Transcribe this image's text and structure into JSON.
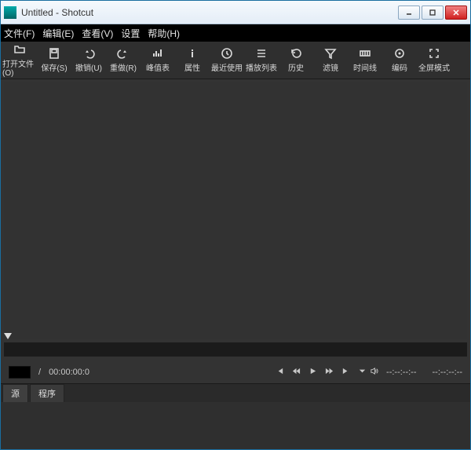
{
  "window": {
    "title": "Untitled - Shotcut"
  },
  "menu": {
    "file": "文件(F)",
    "edit": "编辑(E)",
    "view": "查看(V)",
    "settings": "设置",
    "help": "帮助(H)"
  },
  "toolbar": {
    "open": "打开文件(O)",
    "save": "保存(S)",
    "undo": "撤销(U)",
    "redo": "重做(R)",
    "peak_meter": "峰值表",
    "properties": "属性",
    "recent": "最近使用",
    "playlist": "播放列表",
    "history": "历史",
    "filters": "滤镜",
    "timeline": "时间线",
    "encode": "编码",
    "fullscreen": "全屏模式"
  },
  "timecode": {
    "separator": "/",
    "duration": "00:00:00:0",
    "readout1": "--:--:--:--",
    "readout2": "--:--:--:--"
  },
  "tabs": {
    "source": "源",
    "program": "程序"
  }
}
